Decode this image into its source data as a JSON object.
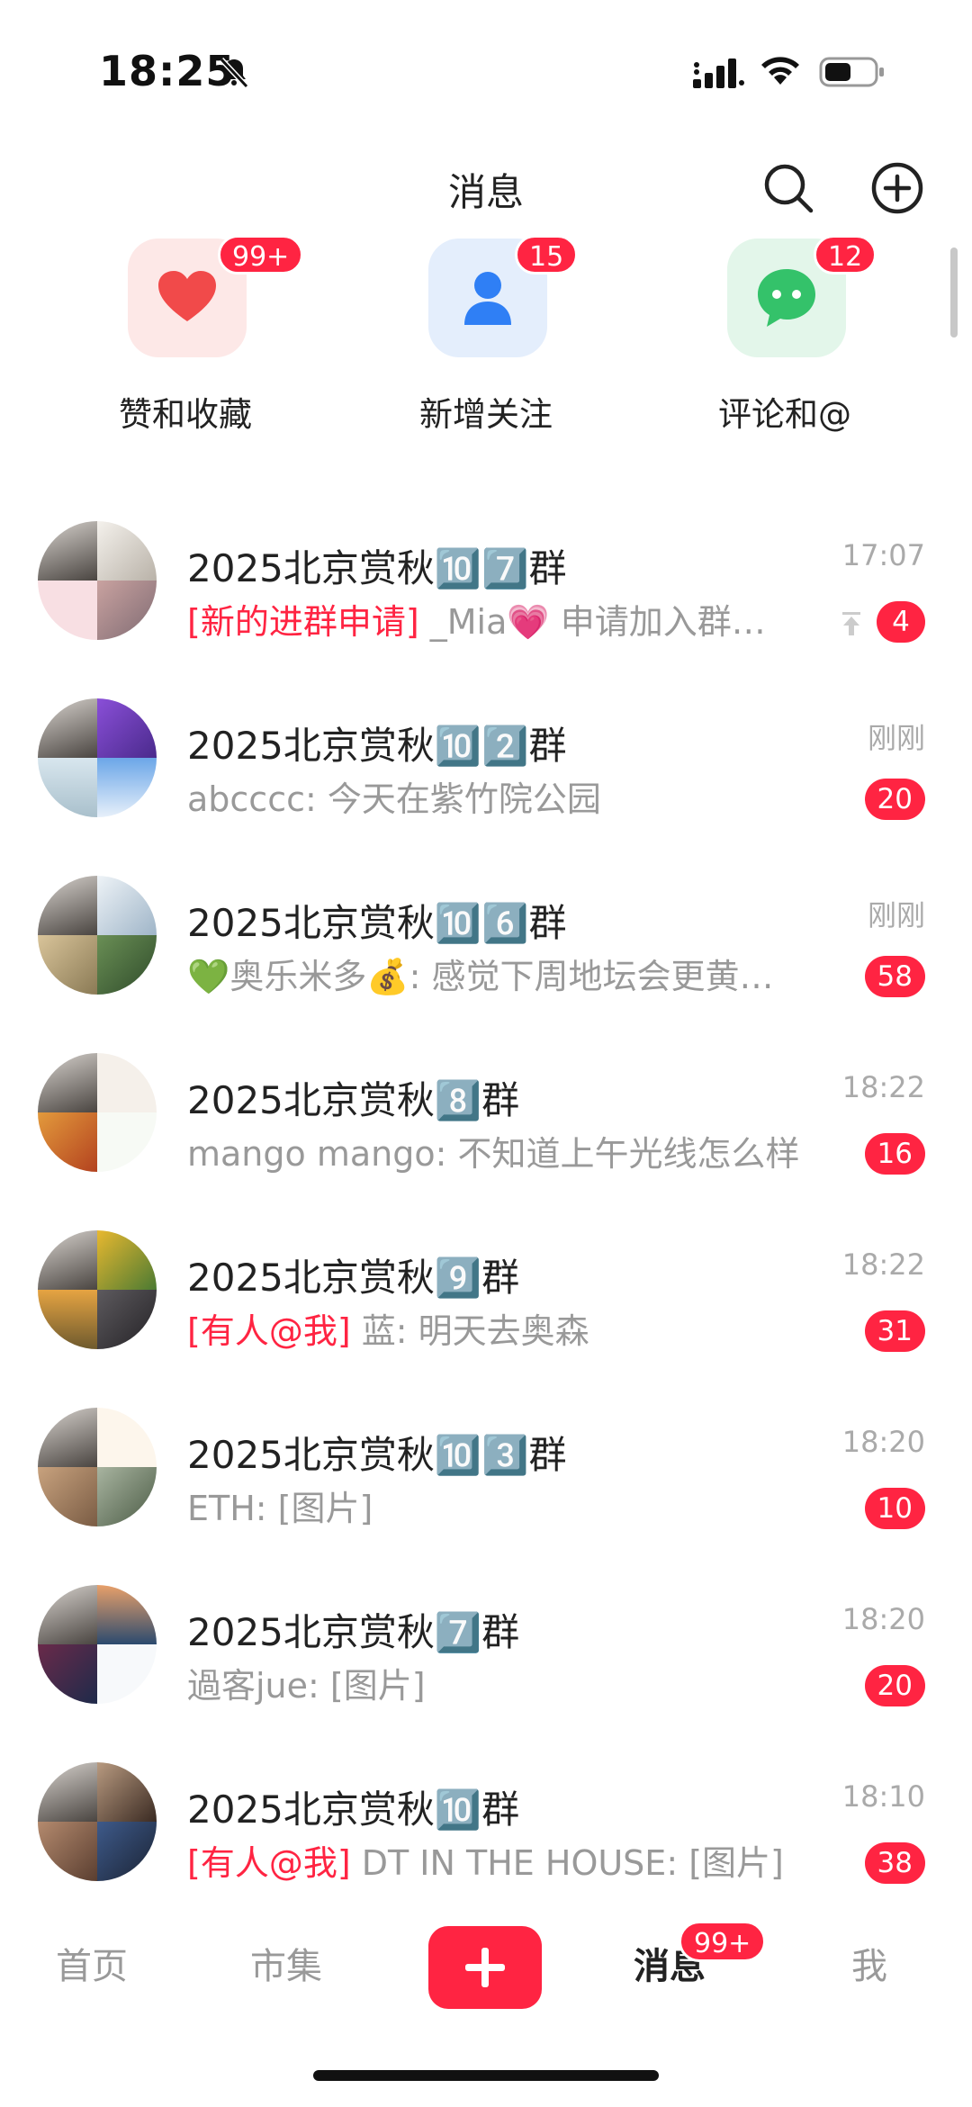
{
  "status_bar": {
    "time": "18:25"
  },
  "header": {
    "title": "消息"
  },
  "quick_entries": [
    {
      "label": "赞和收藏",
      "badge": "99+",
      "icon": "heart-icon",
      "color": "#f14a4a",
      "bg": "#fde8e7"
    },
    {
      "label": "新增关注",
      "badge": "15",
      "icon": "person-icon",
      "color": "#2f7ff5",
      "bg": "#e4eefc"
    },
    {
      "label": "评论和@",
      "badge": "12",
      "icon": "chat-bubble-icon",
      "color": "#34c26a",
      "bg": "#e3f6ea"
    }
  ],
  "conversations": [
    {
      "title": "2025北京赏秋🔟7️⃣群",
      "tag": "[新的进群申请]",
      "preview": "_Mia💗 申请加入群…",
      "time": "17:07",
      "badge": "4",
      "pinned": true
    },
    {
      "title": "2025北京赏秋🔟2️⃣群",
      "tag": "",
      "preview": "abcccc: 今天在紫竹院公园",
      "time": "刚刚",
      "badge": "20",
      "pinned": false
    },
    {
      "title": "2025北京赏秋🔟6️⃣群",
      "tag": "",
      "preview": "💚奥乐米多💰: 感觉下周地坛会更黄…",
      "time": "刚刚",
      "badge": "58",
      "pinned": false
    },
    {
      "title": "2025北京赏秋8️⃣群",
      "tag": "",
      "preview": "mango mango: 不知道上午光线怎么样",
      "time": "18:22",
      "badge": "16",
      "pinned": false
    },
    {
      "title": "2025北京赏秋9️⃣群",
      "tag": "[有人@我]",
      "preview": "蓝: 明天去奥森",
      "time": "18:22",
      "badge": "31",
      "pinned": false
    },
    {
      "title": "2025北京赏秋🔟3️⃣群",
      "tag": "",
      "preview": "ETH: [图片]",
      "time": "18:20",
      "badge": "10",
      "pinned": false
    },
    {
      "title": "2025北京赏秋7️⃣群",
      "tag": "",
      "preview": "過客jue: [图片]",
      "time": "18:20",
      "badge": "20",
      "pinned": false
    },
    {
      "title": "2025北京赏秋🔟群",
      "tag": "[有人@我]",
      "preview": "DT IN THE HOUSE: [图片]",
      "time": "18:10",
      "badge": "38",
      "pinned": false
    }
  ],
  "tabbar": {
    "home": "首页",
    "market": "市集",
    "messages": "消息",
    "messages_badge": "99+",
    "me": "我"
  },
  "colors": {
    "accent": "#ff2442"
  }
}
